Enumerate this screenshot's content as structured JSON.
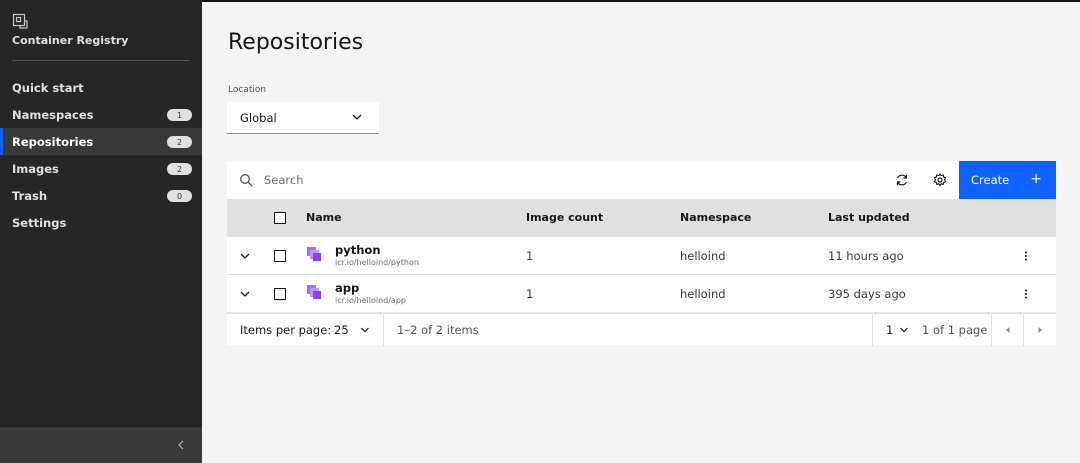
{
  "sidebar": {
    "app_title": "Container Registry",
    "logo_icon": "container-registry-icon",
    "items": [
      {
        "label": "Quick start",
        "badge": null,
        "active": false
      },
      {
        "label": "Namespaces",
        "badge": "1",
        "active": false
      },
      {
        "label": "Repositories",
        "badge": "2",
        "active": true
      },
      {
        "label": "Images",
        "badge": "2",
        "active": false
      },
      {
        "label": "Trash",
        "badge": "0",
        "active": false
      },
      {
        "label": "Settings",
        "badge": null,
        "active": false
      }
    ],
    "collapse_icon": "chevron-left-icon"
  },
  "page": {
    "title": "Repositories",
    "location_label": "Location",
    "location_value": "Global"
  },
  "toolbar": {
    "search_placeholder": "Search",
    "create_label": "Create",
    "create_icon": "plus-icon"
  },
  "table": {
    "headers": {
      "name": "Name",
      "image_count": "Image count",
      "namespace": "Namespace",
      "last_updated": "Last updated"
    },
    "rows": [
      {
        "name": "python",
        "path": "icr.io/helloind/python",
        "image_count": "1",
        "namespace": "helloind",
        "last_updated": "11 hours ago"
      },
      {
        "name": "app",
        "path": "icr.io/helloind/app",
        "image_count": "1",
        "namespace": "helloind",
        "last_updated": "395 days ago"
      }
    ]
  },
  "pagination": {
    "items_per_page_label": "Items per page:",
    "items_per_page": "25",
    "range_text": "1–2 of 2 items",
    "current_page": "1",
    "page_total_text": "1 of 1 page"
  },
  "colors": {
    "sidebar_bg": "#262626",
    "accent": "#0f62fe",
    "repo_icon": "#8a3ffc"
  }
}
